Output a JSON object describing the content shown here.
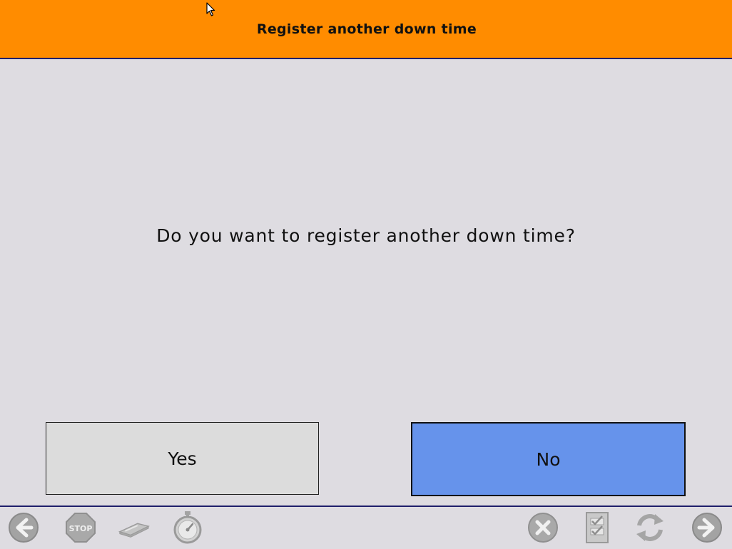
{
  "header": {
    "title": "Register another down time"
  },
  "dialog": {
    "question": "Do you want to register another down time?"
  },
  "buttons": {
    "yes_label": "Yes",
    "no_label": "No"
  },
  "toolbar": {
    "left": [
      "back-arrow-icon",
      "stop-sign-icon",
      "card-reader-icon",
      "stopwatch-icon"
    ],
    "right": [
      "cancel-icon",
      "checklist-icon",
      "refresh-icon",
      "forward-arrow-icon"
    ]
  },
  "colors": {
    "header": "#ff8c00",
    "background": "#dedce1",
    "no_button": "#6693eb",
    "yes_button": "#dcdcdc",
    "rule": "#1f1f6b"
  }
}
